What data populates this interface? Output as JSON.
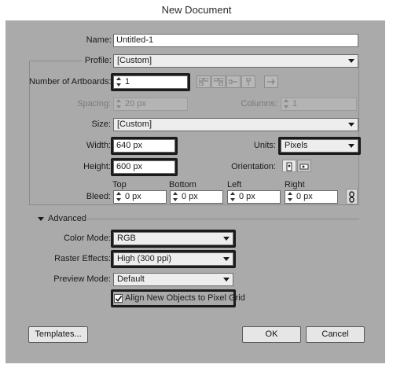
{
  "window": {
    "title": "New Document"
  },
  "name": {
    "label": "Name:",
    "value": "Untitled-1"
  },
  "profile": {
    "label": "Profile:",
    "value": "[Custom]"
  },
  "artboards": {
    "label": "Number of Artboards:",
    "value": "1"
  },
  "spacing": {
    "label": "Spacing:",
    "value": "20 px"
  },
  "columns": {
    "label": "Columns:",
    "value": "1"
  },
  "size": {
    "label": "Size:",
    "value": "[Custom]"
  },
  "width": {
    "label": "Width:",
    "value": "640 px"
  },
  "units": {
    "label": "Units:",
    "value": "Pixels"
  },
  "height": {
    "label": "Height:",
    "value": "600 px"
  },
  "orientation": {
    "label": "Orientation:"
  },
  "bleed": {
    "label": "Bleed:",
    "top": {
      "label": "Top",
      "value": "0 px"
    },
    "bottom": {
      "label": "Bottom",
      "value": "0 px"
    },
    "left": {
      "label": "Left",
      "value": "0 px"
    },
    "right": {
      "label": "Right",
      "value": "0 px"
    }
  },
  "advanced": {
    "label": "Advanced",
    "color_mode": {
      "label": "Color Mode:",
      "value": "RGB"
    },
    "raster_effects": {
      "label": "Raster Effects:",
      "value": "High (300 ppi)"
    },
    "preview_mode": {
      "label": "Preview Mode:",
      "value": "Default"
    },
    "pixel_grid": {
      "label": "Align New Objects to Pixel Grid",
      "checked": true
    }
  },
  "buttons": {
    "templates": "Templates...",
    "ok": "OK",
    "cancel": "Cancel"
  }
}
